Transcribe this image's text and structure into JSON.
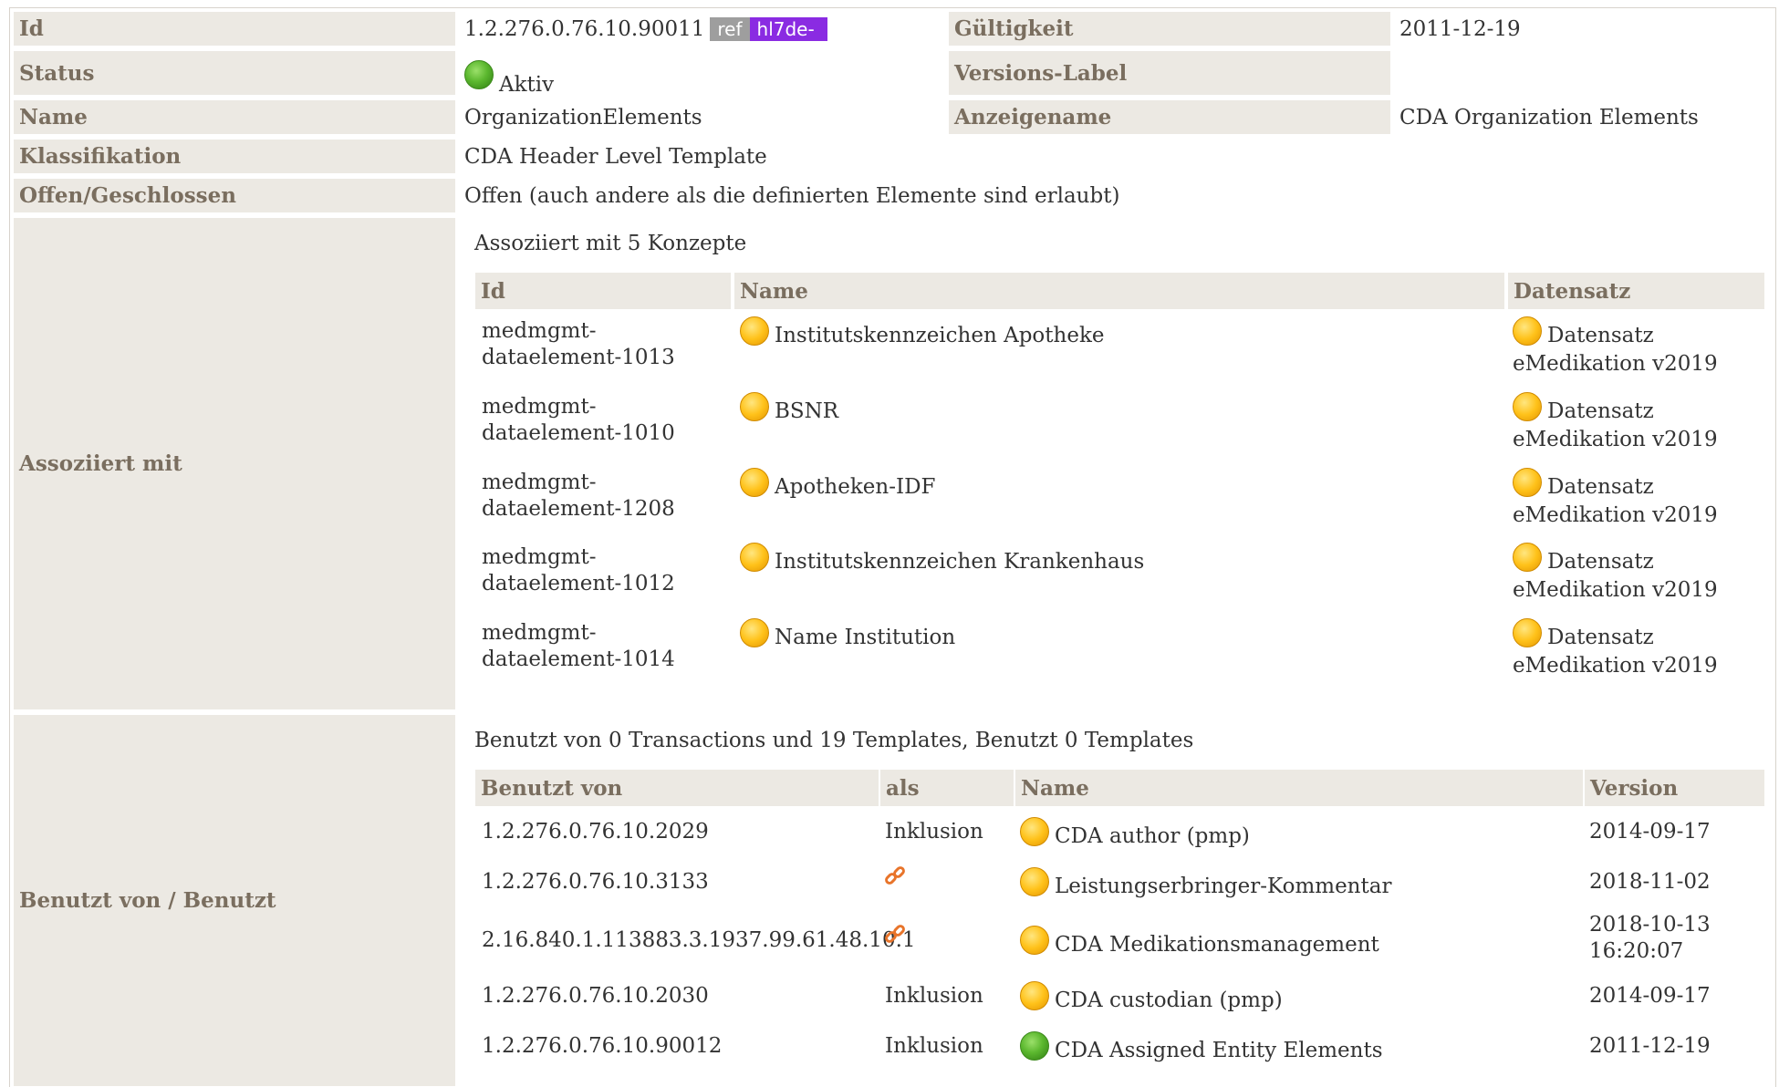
{
  "labels": {
    "id": "Id",
    "status": "Status",
    "name": "Name",
    "classification": "Klassifikation",
    "open_closed": "Offen/Geschlossen",
    "associated": "Assoziiert mit",
    "used_by": "Benutzt von / Benutzt",
    "validity": "Gültigkeit",
    "version_label": "Versions-Label",
    "display_name": "Anzeigename"
  },
  "values": {
    "id": "1.2.276.0.76.10.90011",
    "ref_badge": "ref",
    "hl7_badge": "hl7de-",
    "status": "Aktiv",
    "status_color": "green",
    "name": "OrganizationElements",
    "classification": "CDA Header Level Template",
    "open_closed": "Offen (auch andere als die definierten Elemente sind erlaubt)",
    "validity": "2011-12-19",
    "version_label": "",
    "display_name": "CDA Organization Elements"
  },
  "associated": {
    "caption": "Assoziiert mit 5 Konzepte",
    "headers": [
      "Id",
      "Name",
      "Datensatz"
    ],
    "rows": [
      {
        "id_1": "medmgmt-",
        "id_2": "dataelement-1013",
        "name": "Institutskennzeichen Apotheke",
        "ds_1": "Datensatz",
        "ds_2": "eMedikation v2019"
      },
      {
        "id_1": "medmgmt-",
        "id_2": "dataelement-1010",
        "name": "BSNR",
        "ds_1": "Datensatz",
        "ds_2": "eMedikation v2019"
      },
      {
        "id_1": "medmgmt-",
        "id_2": "dataelement-1208",
        "name": "Apotheken-IDF",
        "ds_1": "Datensatz",
        "ds_2": "eMedikation v2019"
      },
      {
        "id_1": "medmgmt-",
        "id_2": "dataelement-1012",
        "name": "Institutskennzeichen Krankenhaus",
        "ds_1": "Datensatz",
        "ds_2": "eMedikation v2019"
      },
      {
        "id_1": "medmgmt-",
        "id_2": "dataelement-1014",
        "name": "Name Institution",
        "ds_1": "Datensatz",
        "ds_2": "eMedikation v2019"
      }
    ]
  },
  "used_by": {
    "caption": "Benutzt von 0 Transactions und 19 Templates, Benutzt 0 Templates",
    "headers": [
      "Benutzt von",
      "als",
      "Name",
      "Version"
    ],
    "rows": [
      {
        "id": "1.2.276.0.76.10.2029",
        "as": "Inklusion",
        "as_icon": "",
        "name": "CDA author (pmp)",
        "status": "yellow",
        "v1": "2014-09-17",
        "v2": ""
      },
      {
        "id": "1.2.276.0.76.10.3133",
        "as": "",
        "as_icon": "link-icon",
        "name": "Leistungserbringer-Kommentar",
        "status": "yellow",
        "v1": "2018-11-02",
        "v2": ""
      },
      {
        "id": "2.16.840.1.113883.3.1937.99.61.48.10.1",
        "as": "",
        "as_icon": "link-icon",
        "name": "CDA Medikationsmanagement",
        "status": "yellow",
        "v1": "2018-10-13",
        "v2": "16:20:07"
      },
      {
        "id": "1.2.276.0.76.10.2030",
        "as": "Inklusion",
        "as_icon": "",
        "name": "CDA custodian (pmp)",
        "status": "yellow",
        "v1": "2014-09-17",
        "v2": ""
      },
      {
        "id": "1.2.276.0.76.10.90012",
        "as": "Inklusion",
        "as_icon": "",
        "name": "CDA Assigned Entity Elements",
        "status": "green",
        "v1": "2011-12-19",
        "v2": ""
      }
    ]
  },
  "colors": {
    "label_bg": "#ece9e3",
    "label_text": "#7a6e5f",
    "badge_gray": "#9e9e9e",
    "badge_purple": "#8a2be2",
    "link_icon": "#e8742a"
  }
}
